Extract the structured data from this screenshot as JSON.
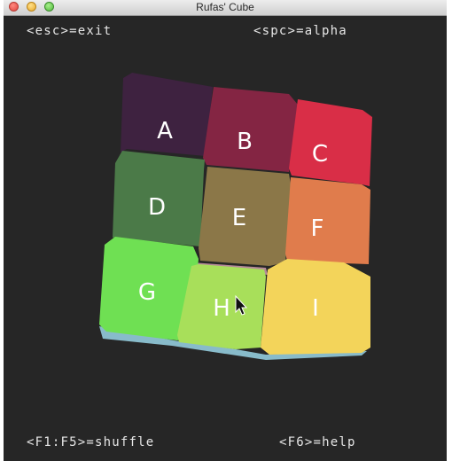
{
  "window": {
    "title": "Rufas' Cube"
  },
  "hints": {
    "exit": "<esc>=exit",
    "alpha": "<spc>=alpha",
    "shuffle": "<F1:F5>=shuffle",
    "help": "<F6>=help"
  },
  "cube": {
    "tiles": [
      {
        "id": "a",
        "label": "A",
        "color": "#3e2240"
      },
      {
        "id": "b",
        "label": "B",
        "color": "#842543"
      },
      {
        "id": "c",
        "label": "C",
        "color": "#d92e47"
      },
      {
        "id": "d",
        "label": "D",
        "color": "#4b7a48"
      },
      {
        "id": "e",
        "label": "E",
        "color": "#8b7748"
      },
      {
        "id": "f",
        "label": "F",
        "color": "#e07c4c"
      },
      {
        "id": "g",
        "label": "G",
        "color": "#6fe053"
      },
      {
        "id": "h",
        "label": "H",
        "color": "#a8df5a"
      },
      {
        "id": "i",
        "label": "I",
        "color": "#f3d45a"
      }
    ]
  },
  "icons": {
    "cursor": "arrow-cursor-icon"
  }
}
